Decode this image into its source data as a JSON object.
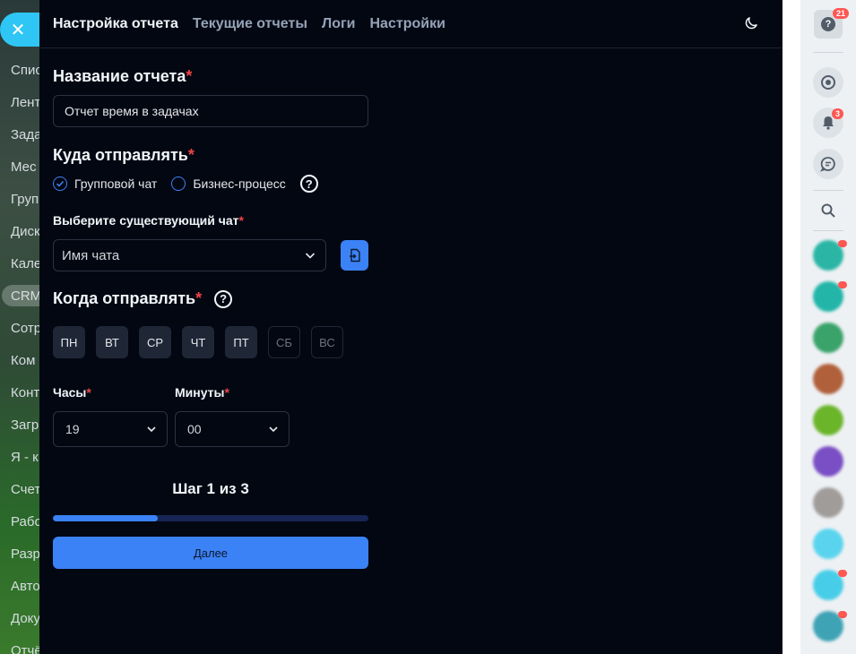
{
  "background_menu": {
    "close_symbol": "✕",
    "items": [
      "Спис",
      "Лент",
      "Зада",
      "Мес",
      "Груп",
      "Диск",
      "Кале",
      "CRM",
      "Сотр",
      "Ком",
      "Конт",
      "Загр",
      "Я - к",
      "Счет",
      "Рабо",
      "Разр",
      "Авто",
      "Доку",
      "Отчё"
    ]
  },
  "header": {
    "tabs": [
      {
        "label": "Настройка отчета",
        "active": true
      },
      {
        "label": "Текущие отчеты",
        "active": false
      },
      {
        "label": "Логи",
        "active": false
      },
      {
        "label": "Настройки",
        "active": false
      }
    ],
    "theme_icon": "moon-icon"
  },
  "form": {
    "report_name_label": "Название отчета",
    "report_name_value": "Отчет время в задачах",
    "destination_label": "Куда отправлять",
    "destination_options": [
      {
        "label": "Групповой чат",
        "checked": true
      },
      {
        "label": "Бизнес-процесс",
        "checked": false
      }
    ],
    "chat_label": "Выберите существующий чат",
    "chat_placeholder": "Имя чата",
    "when_label": "Когда отправлять",
    "days": [
      {
        "label": "ПН",
        "active": true
      },
      {
        "label": "ВТ",
        "active": true
      },
      {
        "label": "СР",
        "active": true
      },
      {
        "label": "ЧТ",
        "active": true
      },
      {
        "label": "ПТ",
        "active": true
      },
      {
        "label": "СБ",
        "active": false
      },
      {
        "label": "ВС",
        "active": false
      }
    ],
    "hours_label": "Часы",
    "hours_value": "19",
    "minutes_label": "Минуты",
    "minutes_value": "00",
    "required_mark": "*",
    "help_symbol": "?"
  },
  "stepper": {
    "title": "Шаг 1 из 3",
    "progress": 0.333,
    "next_label": "Далее"
  },
  "right_sidebar": {
    "help_badge": "21",
    "notifications_badge": "3"
  },
  "colors": {
    "accent": "#3b82f6",
    "required": "#ef4444",
    "panel_bg": "#030712"
  }
}
